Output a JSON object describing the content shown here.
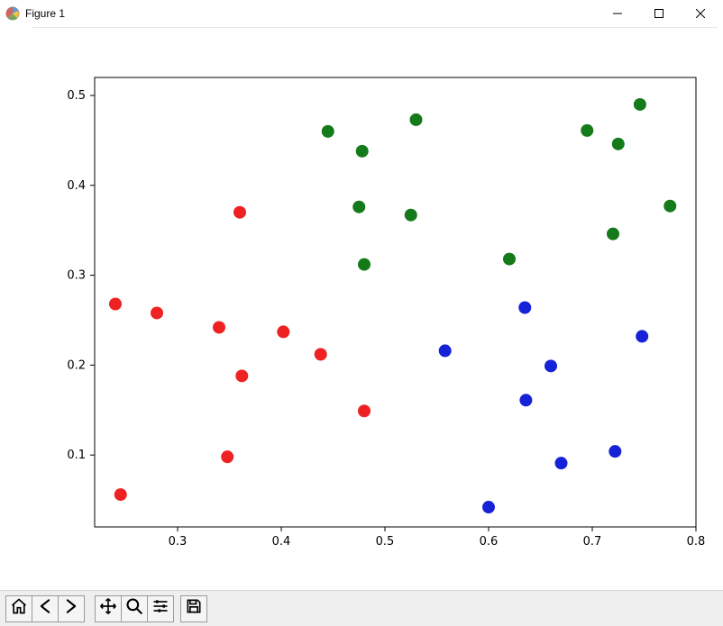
{
  "window": {
    "title": "Figure 1"
  },
  "colors": {
    "red": "#ee2222",
    "green": "#147a1a",
    "blue": "#1522d8",
    "axis": "#000000"
  },
  "toolbar": {
    "home": "Home",
    "back": "Back",
    "forward": "Forward",
    "pan": "Pan",
    "zoom": "Zoom",
    "configure": "Configure subplots",
    "save": "Save"
  },
  "chart_data": {
    "type": "scatter",
    "title": "",
    "xlabel": "",
    "ylabel": "",
    "xlim": [
      0.22,
      0.8
    ],
    "ylim": [
      0.02,
      0.52
    ],
    "xticks": [
      0.3,
      0.4,
      0.5,
      0.6,
      0.7,
      0.8
    ],
    "yticks": [
      0.1,
      0.2,
      0.3,
      0.4,
      0.5
    ],
    "series": [
      {
        "name": "red",
        "color": "#ee2222",
        "points": [
          {
            "x": 0.24,
            "y": 0.268
          },
          {
            "x": 0.28,
            "y": 0.258
          },
          {
            "x": 0.34,
            "y": 0.242
          },
          {
            "x": 0.36,
            "y": 0.37
          },
          {
            "x": 0.362,
            "y": 0.188
          },
          {
            "x": 0.348,
            "y": 0.098
          },
          {
            "x": 0.402,
            "y": 0.237
          },
          {
            "x": 0.438,
            "y": 0.212
          },
          {
            "x": 0.48,
            "y": 0.149
          },
          {
            "x": 0.245,
            "y": 0.056
          }
        ]
      },
      {
        "name": "green",
        "color": "#147a1a",
        "points": [
          {
            "x": 0.445,
            "y": 0.46
          },
          {
            "x": 0.478,
            "y": 0.438
          },
          {
            "x": 0.475,
            "y": 0.376
          },
          {
            "x": 0.48,
            "y": 0.312
          },
          {
            "x": 0.525,
            "y": 0.367
          },
          {
            "x": 0.53,
            "y": 0.473
          },
          {
            "x": 0.62,
            "y": 0.318
          },
          {
            "x": 0.695,
            "y": 0.461
          },
          {
            "x": 0.72,
            "y": 0.346
          },
          {
            "x": 0.725,
            "y": 0.446
          },
          {
            "x": 0.746,
            "y": 0.49
          },
          {
            "x": 0.775,
            "y": 0.377
          }
        ]
      },
      {
        "name": "blue",
        "color": "#1522d8",
        "points": [
          {
            "x": 0.558,
            "y": 0.216
          },
          {
            "x": 0.6,
            "y": 0.042
          },
          {
            "x": 0.635,
            "y": 0.264
          },
          {
            "x": 0.636,
            "y": 0.161
          },
          {
            "x": 0.66,
            "y": 0.199
          },
          {
            "x": 0.67,
            "y": 0.091
          },
          {
            "x": 0.722,
            "y": 0.104
          },
          {
            "x": 0.748,
            "y": 0.232
          }
        ]
      }
    ]
  }
}
